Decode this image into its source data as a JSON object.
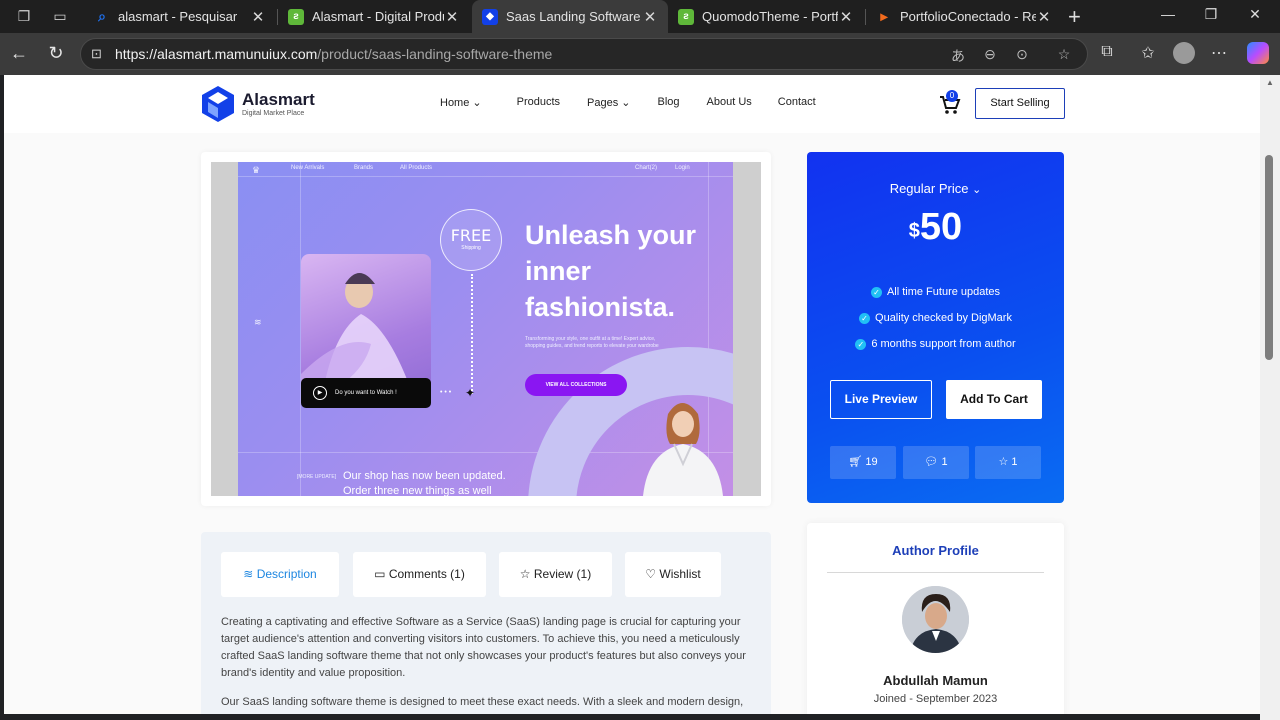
{
  "browser": {
    "tabs": [
      {
        "title": "alasmart - Pesquisar",
        "favicon_color": "#1f6feb",
        "favicon_glyph": "⌕"
      },
      {
        "title": "Alasmart - Digital Produc",
        "favicon_color": "#5fb83a",
        "favicon_glyph": "ƨ"
      },
      {
        "title": "Saas Landing Software Th",
        "favicon_color": "#1240e8",
        "favicon_glyph": "◆"
      },
      {
        "title": "QuomodoTheme - Portfo",
        "favicon_color": "#5fb83a",
        "favicon_glyph": "ƨ"
      },
      {
        "title": "PortfolioConectado - Rep",
        "favicon_color": "#f26b1d",
        "favicon_glyph": "▸"
      }
    ],
    "active_tab": 2,
    "url_host": "https://alasmart.mamunuiux.com",
    "url_path": "/product/saas-landing-software-theme"
  },
  "site": {
    "logo_name": "Alasmart",
    "logo_sub": "Digital Market Place",
    "menu": [
      "Home ⌄",
      "Products",
      "Pages ⌄",
      "Blog",
      "About Us",
      "Contact"
    ],
    "cart_count": "0",
    "start_selling": "Start Selling"
  },
  "preview": {
    "nav_left": [
      "New Arrivals",
      "Brands",
      "All Products"
    ],
    "nav_right": [
      "Chart(2)",
      "Login"
    ],
    "badge_main": "FREE",
    "badge_sub": "Shipping",
    "headline": "Unleash your inner fashionista.",
    "para": "Transforming your style, one outfit at a time! Expert advice, shopping guides, and trend reports to elevate your wardrobe",
    "cta": "VIEW ALL COLLECTIONS",
    "video_label": "Do you want to Watch !",
    "update_tag": "[MORE UPDATE]",
    "update_text": "Our shop has now been updated. Order three new things as well"
  },
  "pricing": {
    "label": "Regular Price",
    "currency": "$",
    "amount": "50",
    "features": [
      "All time Future updates",
      "Quality checked by DigMark",
      "6 months support from author"
    ],
    "live_preview": "Live Preview",
    "add_to_cart": "Add To Cart",
    "stats": {
      "sales": "19",
      "comments": "1",
      "rating": "1"
    },
    "colors": {
      "accent": "#1232f0",
      "check": "#21c0f5"
    }
  },
  "tabs": {
    "description": "Description",
    "comments": "Comments (1)",
    "review": "Review (1)",
    "wishlist": "Wishlist"
  },
  "description": {
    "p1": "Creating a captivating and effective Software as a Service (SaaS) landing page is crucial for capturing your target audience's attention and converting visitors into customers. To achieve this, you need a meticulously crafted SaaS landing software theme that not only showcases your product's features but also conveys your brand's identity and value proposition.",
    "p2": "Our SaaS landing software theme is designed to meet these exact needs. With a sleek and modern design,"
  },
  "author": {
    "title": "Author Profile",
    "name": "Abdullah Mamun",
    "joined": "Joined - September 2023"
  }
}
